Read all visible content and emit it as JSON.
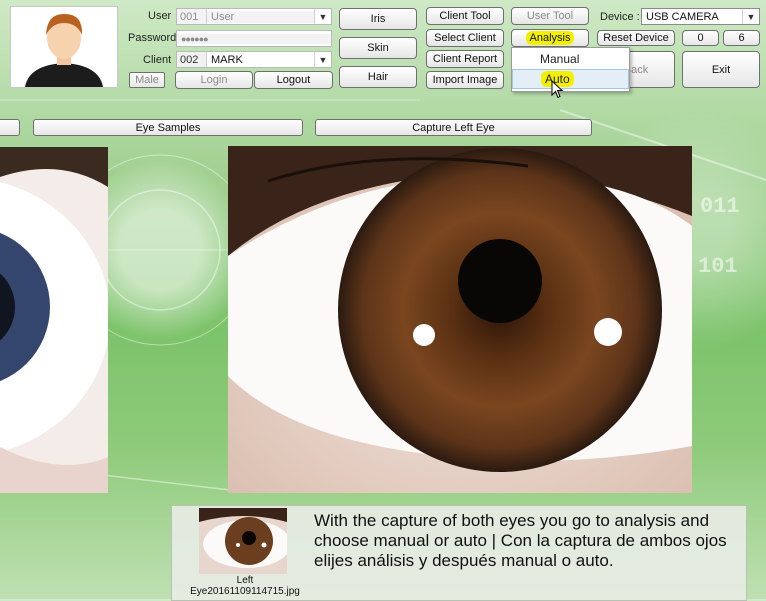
{
  "login": {
    "user_label": "User",
    "user_code": "001",
    "user_value": "User",
    "password_label": "Password",
    "password_value": "●●●●●●",
    "client_label": "Client",
    "client_code": "002",
    "client_value": "MARK",
    "gender": "Male",
    "login_button": "Login",
    "logout_button": "Logout"
  },
  "modes": {
    "iris": "Iris",
    "skin": "Skin",
    "hair": "Hair"
  },
  "client_buttons": {
    "client_tool": "Client Tool",
    "select_client": "Select Client",
    "client_report": "Client Report",
    "import_image": "Import Image"
  },
  "tools": {
    "user_tool": "User Tool",
    "analysis": "Analysis",
    "analysis_options": [
      "Manual",
      "Auto"
    ],
    "back": "Back",
    "exit": "Exit"
  },
  "device": {
    "label": "Device :",
    "selected": "USB CAMERA",
    "reset_button": "Reset Device",
    "counter_left": "0",
    "counter_right": "6"
  },
  "bars": {
    "eye_samples": "Eye Samples",
    "capture_left_eye": "Capture Left Eye"
  },
  "thumbnail": {
    "side": "Left",
    "filename": "Eye20161109114715.jpg"
  },
  "caption": "With the capture of both eyes you go to analysis and choose manual or auto | Con la captura de ambos ojos elijes análisis y después manual o auto.",
  "colors": {
    "highlight": "#f2f000",
    "background_green": "#7cc36a",
    "iris_brown": "#6b3e1f"
  }
}
